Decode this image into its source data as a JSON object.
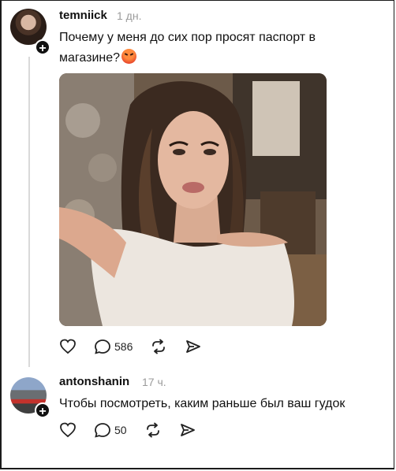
{
  "posts": [
    {
      "username": "temniick",
      "time": "1 дн.",
      "text": "Почему у меня до сих пор просят паспорт в магазине?",
      "emoji": "angry-face",
      "image": "selfie-photo",
      "actions": {
        "like": "",
        "comments": "586",
        "repost": "",
        "share": ""
      }
    },
    {
      "username": "antonshanin",
      "time": "17 ч.",
      "text": "Чтобы посмотреть, каким раньше был ваш гудок",
      "actions": {
        "like": "",
        "comments": "50",
        "repost": "",
        "share": ""
      }
    }
  ],
  "icons": [
    "heart-icon",
    "comment-icon",
    "repost-icon",
    "share-icon",
    "plus-icon"
  ],
  "colors": {
    "text": "#111111",
    "muted": "#9b9b9b",
    "thread": "#d9d9d9"
  }
}
